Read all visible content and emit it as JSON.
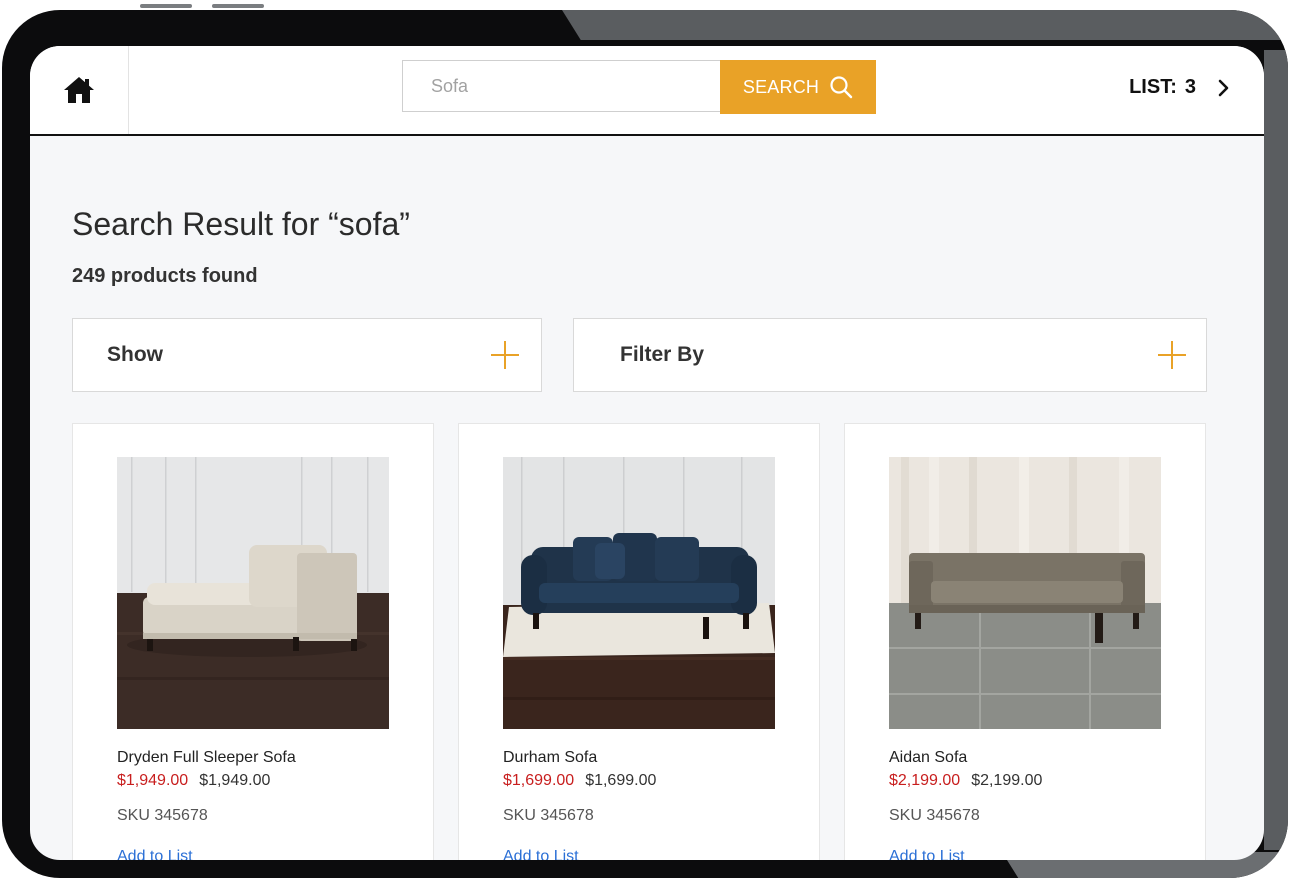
{
  "header": {
    "search": {
      "placeholder": "Sofa",
      "button_label": "SEARCH"
    },
    "list": {
      "label": "LIST:",
      "count": "3"
    }
  },
  "results": {
    "title": "Search Result for “sofa”",
    "count_text": "249 products found"
  },
  "accordions": {
    "show": {
      "label": "Show"
    },
    "filter": {
      "label": "Filter By"
    }
  },
  "products": [
    {
      "name": "Dryden Full Sleeper Sofa",
      "sale_price": "$1,949.00",
      "price": "$1,949.00",
      "sku": "SKU 345678",
      "action": "Add to List"
    },
    {
      "name": "Durham Sofa",
      "sale_price": "$1,699.00",
      "price": "$1,699.00",
      "sku": "SKU 345678",
      "action": "Add to List"
    },
    {
      "name": "Aidan Sofa",
      "sale_price": "$2,199.00",
      "price": "$2,199.00",
      "sku": "SKU 345678",
      "action": "Add to List"
    }
  ],
  "colors": {
    "accent": "#e9a227",
    "sale_price": "#c81e1e",
    "link": "#2a6fd6"
  }
}
